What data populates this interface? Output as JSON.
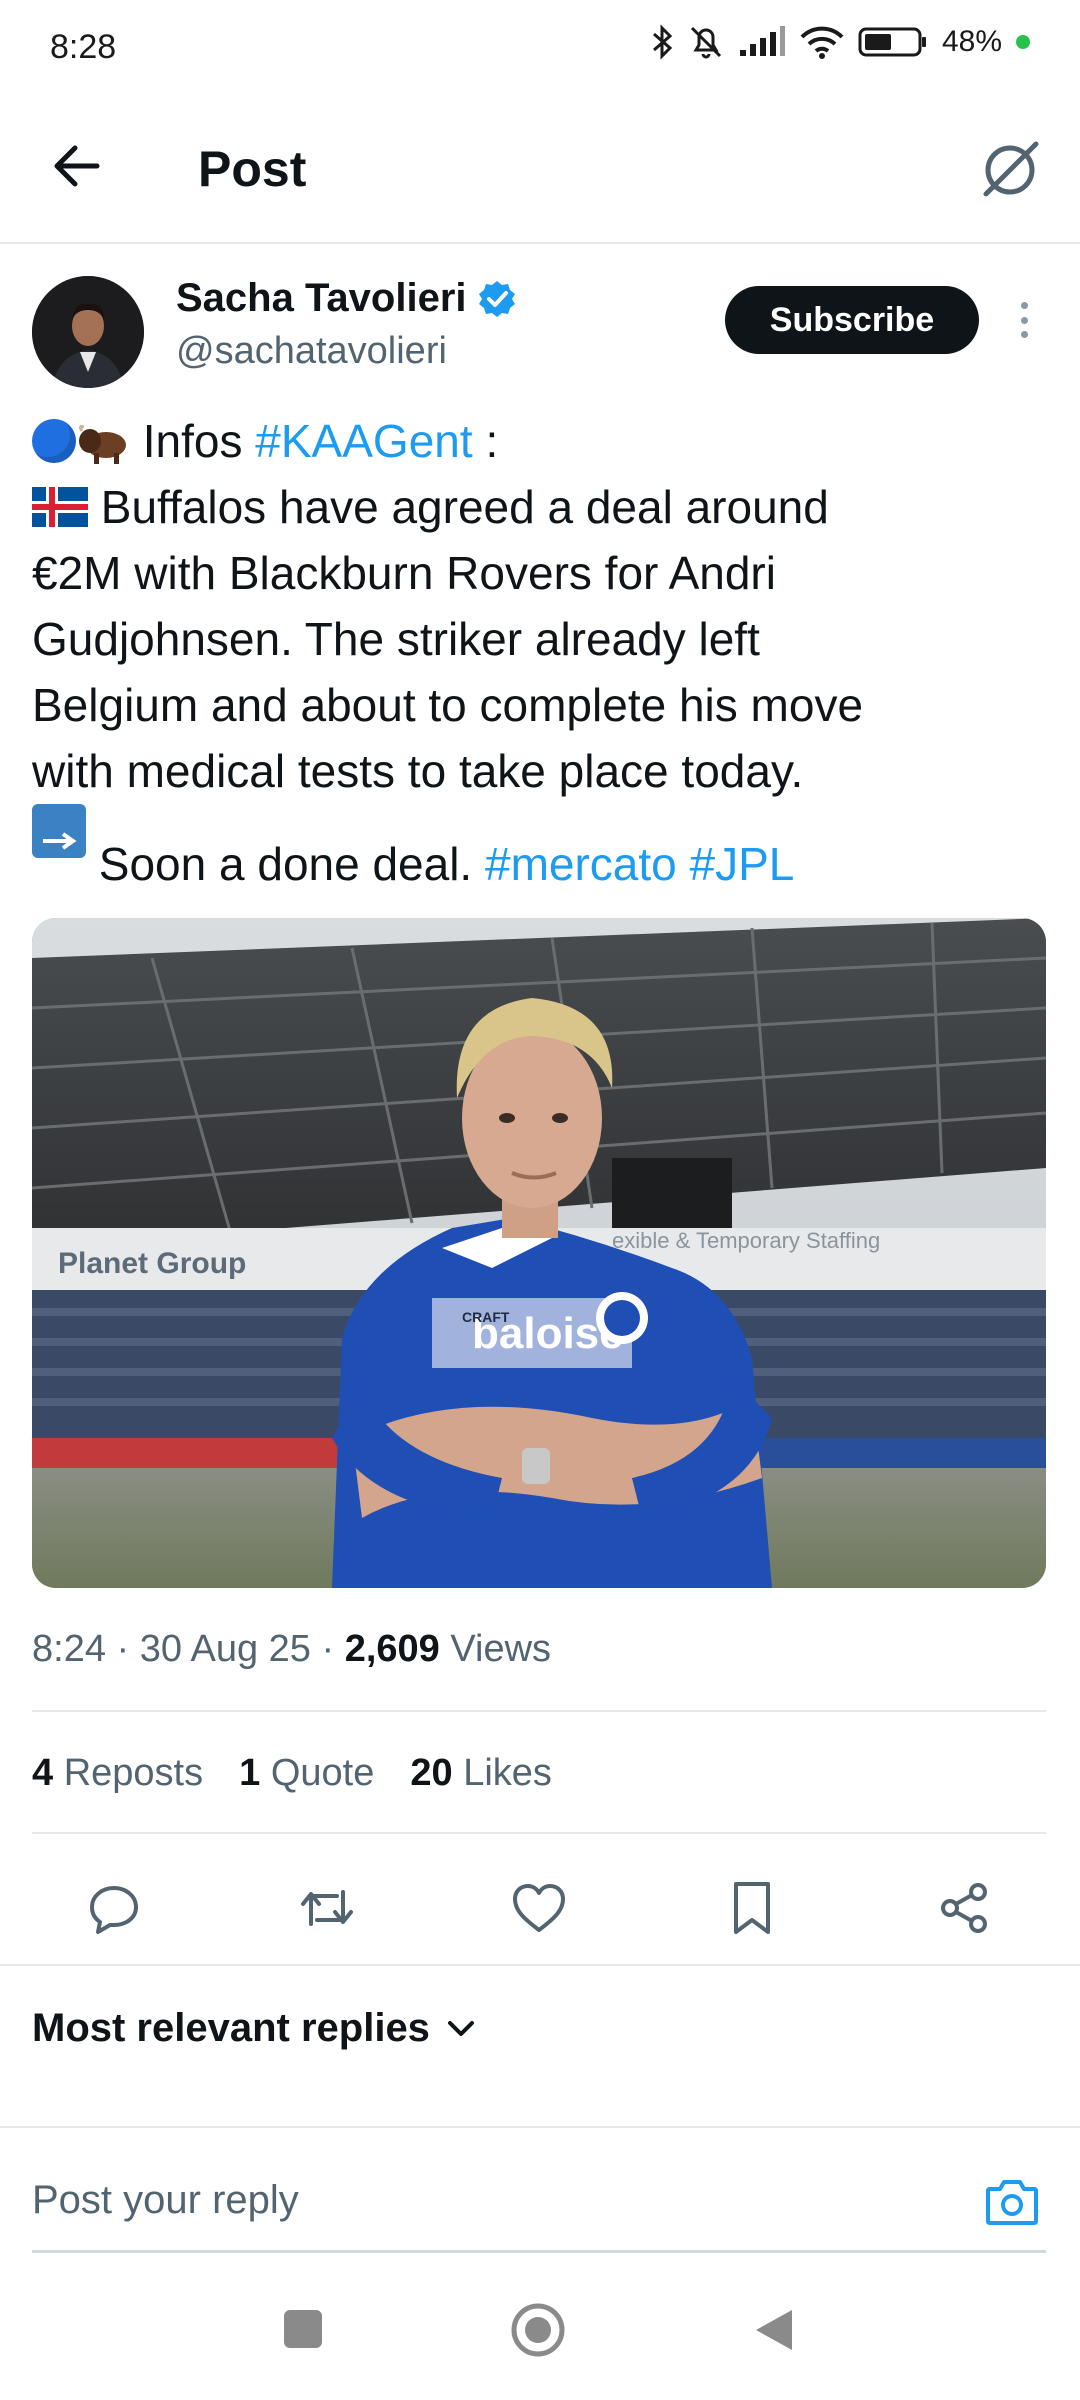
{
  "status_bar": {
    "time": "8:28",
    "battery": "48%"
  },
  "header": {
    "title": "Post"
  },
  "author": {
    "name": "Sacha Tavolieri",
    "handle": "@sachatavolieri",
    "subscribe_label": "Subscribe"
  },
  "tweet": {
    "line1_prefix": "Infos",
    "line1_tag": "#KAAGent",
    "line1_suffix": ":",
    "line2": "Buffalos have agreed a deal around",
    "line3": "€2M with Blackburn Rovers for Andri",
    "line4": "Gudjohnsen. The striker already left",
    "line5": "Belgium and about to complete his move",
    "line6": "with medical tests to take place today.",
    "line7_text": "Soon a done deal.",
    "line7_tag1": "#mercato",
    "line7_tag2": "#JPL",
    "soon_icon_text": "SOON"
  },
  "media": {
    "banner_left": "Planet Group",
    "banner_right": "exible & Temporary Staffing",
    "jersey_sponsor": "baloise",
    "jersey_brand": "CRAFT"
  },
  "meta": {
    "time": "8:24",
    "date": "30 Aug 25",
    "views_count": "2,609",
    "views_label": "Views"
  },
  "stats": {
    "reposts_count": "4",
    "reposts_label": "Reposts",
    "quotes_count": "1",
    "quotes_label": "Quote",
    "likes_count": "20",
    "likes_label": "Likes"
  },
  "replies": {
    "sort_label": "Most relevant replies"
  },
  "reply_bar": {
    "placeholder": "Post your reply"
  },
  "icons": {
    "status": [
      "bluetooth-icon",
      "bell-off-icon",
      "signal-icon",
      "wifi-icon",
      "battery-icon"
    ],
    "actions": [
      "reply-icon",
      "repost-icon",
      "like-icon",
      "bookmark-icon",
      "share-icon"
    ]
  },
  "colors": {
    "accent": "#1d9bf0",
    "verified": "#1d9bf0",
    "text": "#0f1419",
    "muted": "#536471",
    "battery_dot": "#27c24c"
  }
}
